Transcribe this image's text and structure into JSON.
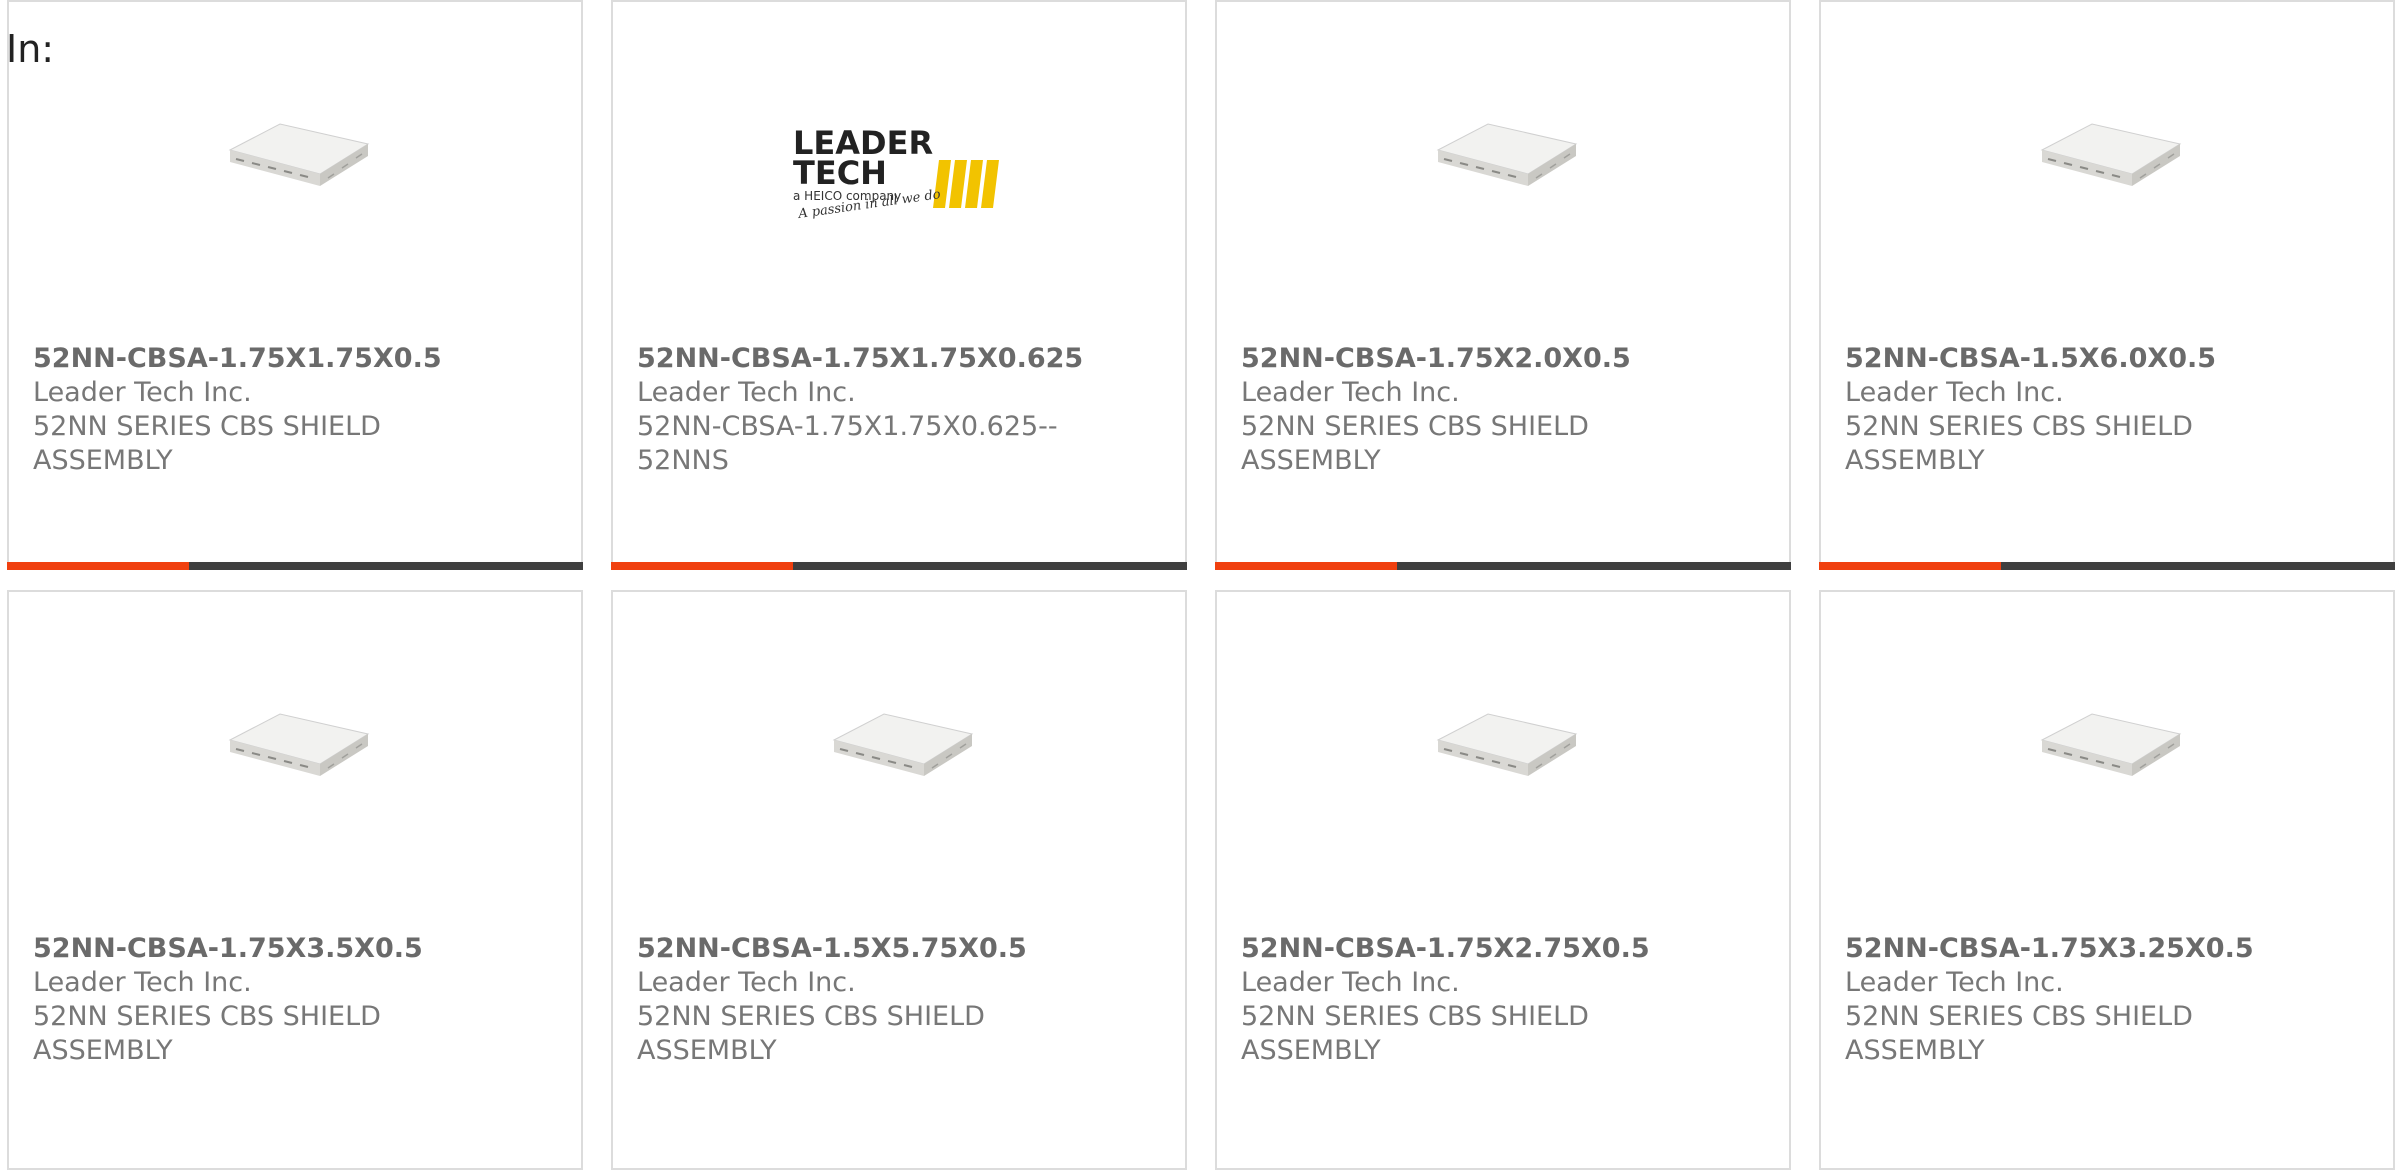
{
  "header": {
    "label": "In:"
  },
  "colors": {
    "accent": "#f0400f",
    "bar": "#3f3f3f"
  },
  "products": [
    {
      "part": "52NN-CBSA-1.75X1.75X0.5",
      "maker": "Leader Tech Inc.",
      "desc_line1": "52NN SERIES CBS SHIELD",
      "desc_line2": "ASSEMBLY",
      "image": "shield-assembly-icon"
    },
    {
      "part": "52NN-CBSA-1.75X1.75X0.625",
      "maker": "Leader Tech Inc.",
      "desc_line1": "52NN-CBSA-1.75X1.75X0.625--",
      "desc_line2": "52NNS",
      "image": "leader-tech-logo",
      "logo_text": {
        "line1": "LEADER",
        "line2": "TECH",
        "tagline": "a HEICO company",
        "script": "A passion in all we do"
      }
    },
    {
      "part": "52NN-CBSA-1.75X2.0X0.5",
      "maker": "Leader Tech Inc.",
      "desc_line1": "52NN SERIES CBS SHIELD",
      "desc_line2": "ASSEMBLY",
      "image": "shield-assembly-icon"
    },
    {
      "part": "52NN-CBSA-1.5X6.0X0.5",
      "maker": "Leader Tech Inc.",
      "desc_line1": "52NN SERIES CBS SHIELD",
      "desc_line2": "ASSEMBLY",
      "image": "shield-assembly-icon"
    },
    {
      "part": "52NN-CBSA-1.75X3.5X0.5",
      "maker": "Leader Tech Inc.",
      "desc_line1": "52NN SERIES CBS SHIELD",
      "desc_line2": "ASSEMBLY",
      "image": "shield-assembly-icon"
    },
    {
      "part": "52NN-CBSA-1.5X5.75X0.5",
      "maker": "Leader Tech Inc.",
      "desc_line1": "52NN SERIES CBS SHIELD",
      "desc_line2": "ASSEMBLY",
      "image": "shield-assembly-icon"
    },
    {
      "part": "52NN-CBSA-1.75X2.75X0.5",
      "maker": "Leader Tech Inc.",
      "desc_line1": "52NN SERIES CBS SHIELD",
      "desc_line2": "ASSEMBLY",
      "image": "shield-assembly-icon"
    },
    {
      "part": "52NN-CBSA-1.75X3.25X0.5",
      "maker": "Leader Tech Inc.",
      "desc_line1": "52NN SERIES CBS SHIELD",
      "desc_line2": "ASSEMBLY",
      "image": "shield-assembly-icon"
    }
  ]
}
